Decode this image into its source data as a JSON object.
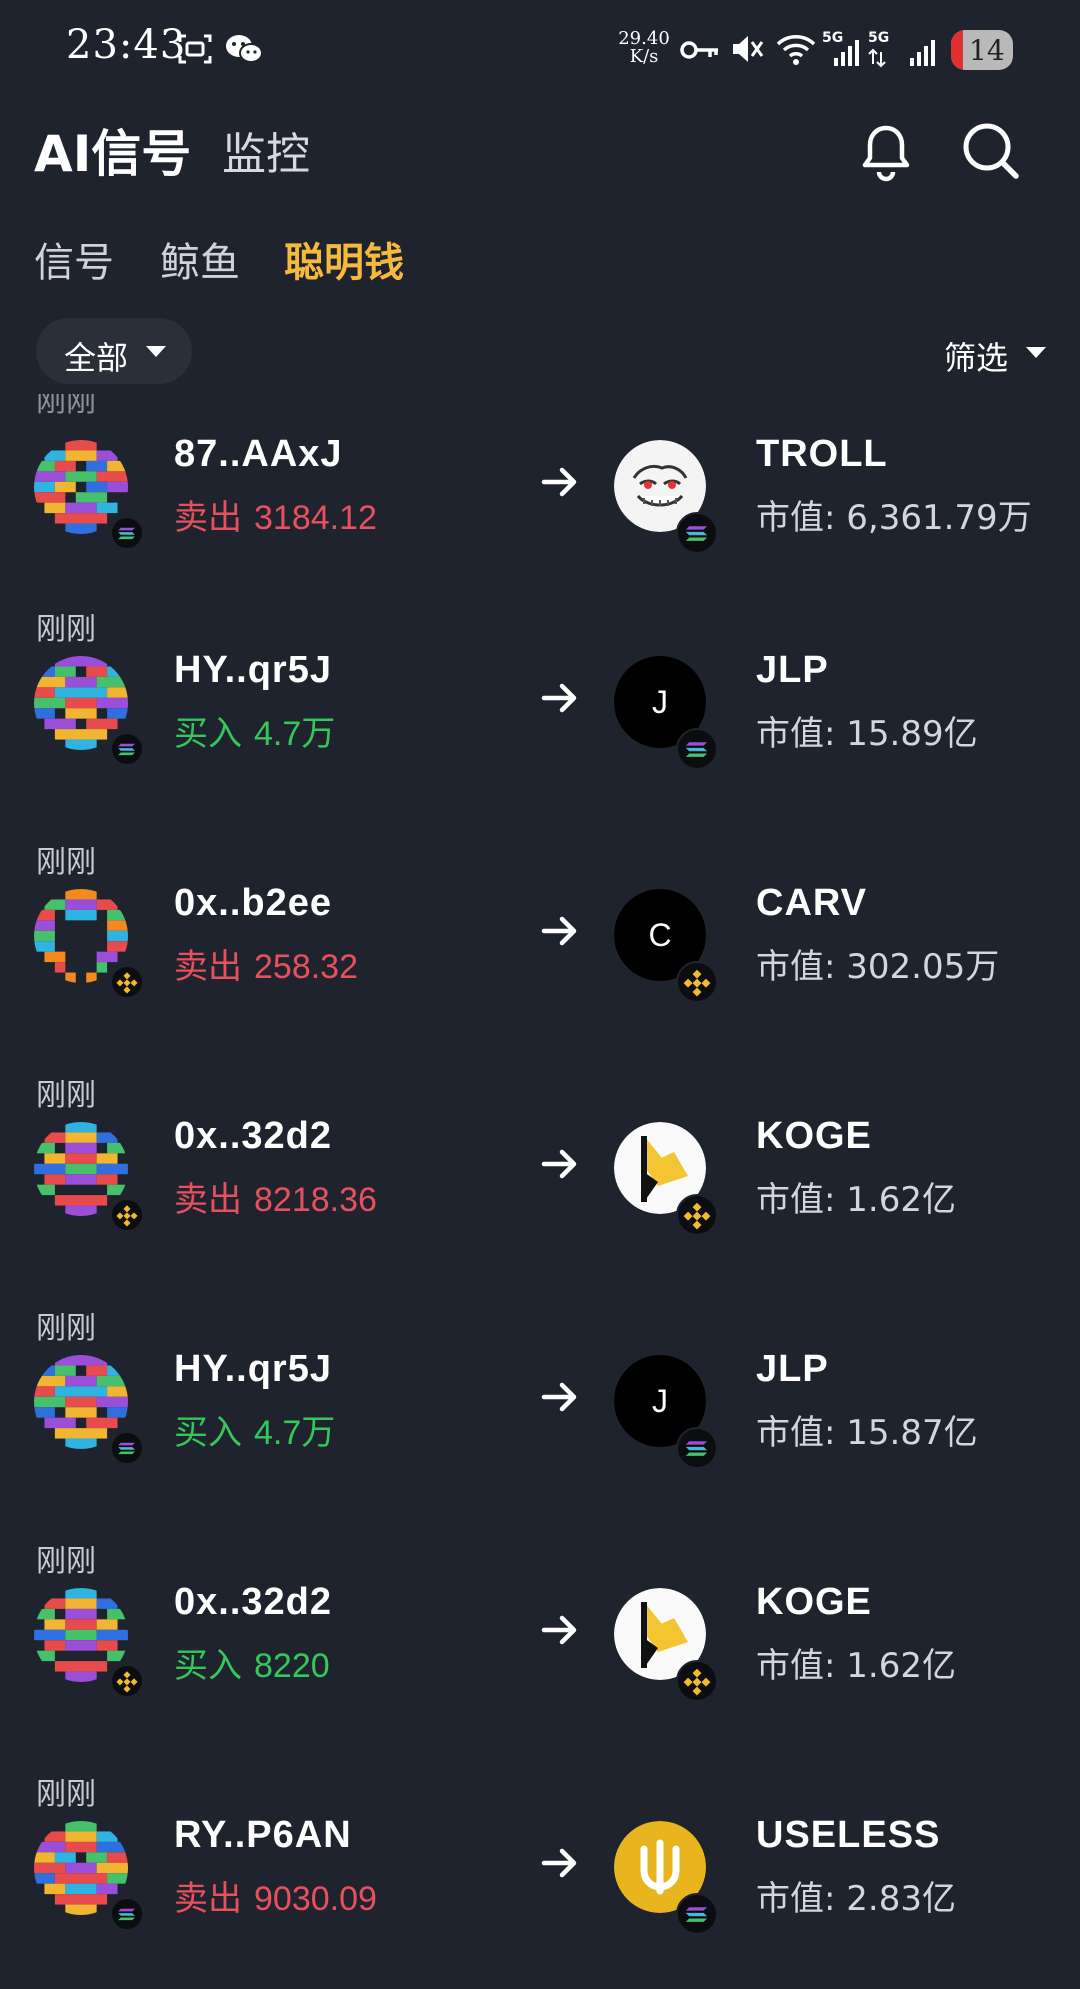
{
  "status_bar": {
    "time": "23:43",
    "net_speed_value": "29.40",
    "net_speed_unit": "K/s",
    "signal_label_1": "5G",
    "signal_label_2": "5G",
    "battery": "14"
  },
  "header": {
    "title": "AI信号",
    "monitor_label": "监控"
  },
  "tabs": [
    {
      "label": "信号"
    },
    {
      "label": "鲸鱼"
    },
    {
      "label": "聪明钱"
    }
  ],
  "active_tab": "聪明钱",
  "filter_bar": {
    "scope_label": "全部",
    "filter_label": "筛选"
  },
  "colors": {
    "background": "#1f232d",
    "accent": "#f5b93e",
    "sell": "#e8505f",
    "buy": "#34c75a"
  },
  "rows": [
    {
      "time": "刚刚",
      "address": "87..AAxJ",
      "action": "卖出",
      "amount": "3184.12",
      "side": "sell",
      "chain": "solana",
      "token": "TROLL",
      "market_cap_label": "市值:",
      "market_cap": "6,361.79万",
      "logo": "troll-face-icon"
    },
    {
      "time": "刚刚",
      "address": "HY..qr5J",
      "action": "买入",
      "amount": "4.7万",
      "side": "buy",
      "chain": "solana",
      "token": "JLP",
      "market_cap_label": "市值:",
      "market_cap": "15.89亿",
      "logo": "letter",
      "logo_letter": "J"
    },
    {
      "time": "刚刚",
      "address": "0x..b2ee",
      "action": "卖出",
      "amount": "258.32",
      "side": "sell",
      "chain": "bnb",
      "token": "CARV",
      "market_cap_label": "市值:",
      "market_cap": "302.05万",
      "logo": "letter",
      "logo_letter": "C"
    },
    {
      "time": "刚刚",
      "address": "0x..32d2",
      "action": "卖出",
      "amount": "8218.36",
      "side": "sell",
      "chain": "bnb",
      "token": "KOGE",
      "market_cap_label": "市值:",
      "market_cap": "1.62亿",
      "logo": "koge-logo-icon"
    },
    {
      "time": "刚刚",
      "address": "HY..qr5J",
      "action": "买入",
      "amount": "4.7万",
      "side": "buy",
      "chain": "solana",
      "token": "JLP",
      "market_cap_label": "市值:",
      "market_cap": "15.87亿",
      "logo": "letter",
      "logo_letter": "J"
    },
    {
      "time": "刚刚",
      "address": "0x..32d2",
      "action": "买入",
      "amount": "8220",
      "side": "buy",
      "chain": "bnb",
      "token": "KOGE",
      "market_cap_label": "市值:",
      "market_cap": "1.62亿",
      "logo": "koge-logo-icon"
    },
    {
      "time": "刚刚",
      "address": "RY..P6AN",
      "action": "卖出",
      "amount": "9030.09",
      "side": "sell",
      "chain": "solana",
      "token": "USELESS",
      "market_cap_label": "市值:",
      "market_cap": "2.83亿",
      "logo": "useless-logo-icon"
    }
  ]
}
